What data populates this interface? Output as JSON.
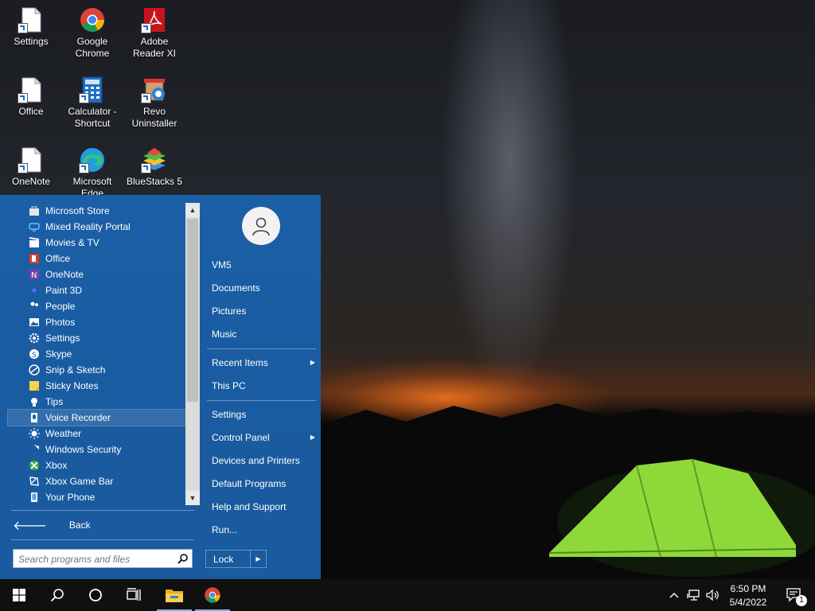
{
  "desktop": {
    "icons": [
      {
        "label": "Settings"
      },
      {
        "label": "Google Chrome"
      },
      {
        "label": "Adobe Reader XI"
      },
      {
        "label": "Office"
      },
      {
        "label": "Calculator - Shortcut"
      },
      {
        "label": "Revo Uninstaller"
      },
      {
        "label": "OneNote"
      },
      {
        "label": "Microsoft Edge"
      },
      {
        "label": "BlueStacks 5"
      }
    ]
  },
  "start_menu": {
    "programs": [
      {
        "label": "Microsoft Store",
        "icon": "store-icon",
        "color": "#e8e8e8"
      },
      {
        "label": "Mixed Reality Portal",
        "icon": "mixed-reality-icon",
        "color": "#5cc3ff"
      },
      {
        "label": "Movies & TV",
        "icon": "movies-icon",
        "color": "#ffffff"
      },
      {
        "label": "Office",
        "icon": "office-icon",
        "color": "#e03c1a"
      },
      {
        "label": "OneNote",
        "icon": "onenote-icon",
        "color": "#7b3fa8"
      },
      {
        "label": "Paint 3D",
        "icon": "paint3d-icon",
        "color": "#f0a030"
      },
      {
        "label": "People",
        "icon": "people-icon",
        "color": "#ffffff"
      },
      {
        "label": "Photos",
        "icon": "photos-icon",
        "color": "#ffffff"
      },
      {
        "label": "Settings",
        "icon": "gear-icon",
        "color": "#ffffff"
      },
      {
        "label": "Skype",
        "icon": "skype-icon",
        "color": "#ffffff"
      },
      {
        "label": "Snip & Sketch",
        "icon": "snip-icon",
        "color": "#ffffff"
      },
      {
        "label": "Sticky Notes",
        "icon": "sticky-notes-icon",
        "color": "#f8d44a"
      },
      {
        "label": "Tips",
        "icon": "tips-icon",
        "color": "#ffffff"
      },
      {
        "label": "Voice Recorder",
        "icon": "microphone-icon",
        "color": "#ffffff",
        "selected": true
      },
      {
        "label": "Weather",
        "icon": "weather-icon",
        "color": "#ffffff"
      },
      {
        "label": "Windows Security",
        "icon": "shield-icon",
        "color": "#ffffff"
      },
      {
        "label": "Xbox",
        "icon": "xbox-icon",
        "color": "#3ab03a"
      },
      {
        "label": "Xbox Game Bar",
        "icon": "game-bar-icon",
        "color": "#ffffff"
      },
      {
        "label": "Your Phone",
        "icon": "phone-icon",
        "color": "#ffffff"
      }
    ],
    "back_label": "Back",
    "search_placeholder": "Search programs and files",
    "right_items": {
      "user": "VM5",
      "documents": "Documents",
      "pictures": "Pictures",
      "music": "Music",
      "recent_items": "Recent Items",
      "this_pc": "This PC",
      "settings": "Settings",
      "control_panel": "Control Panel",
      "devices_printers": "Devices and Printers",
      "default_programs": "Default Programs",
      "help_support": "Help and Support",
      "run": "Run..."
    },
    "lock_label": "Lock"
  },
  "taskbar": {
    "time": "6:50 PM",
    "date": "5/4/2022",
    "notification_count": "1"
  },
  "colors": {
    "start_menu_bg": "#1b5fa6",
    "taskbar_bg": "#101010",
    "accent": "#7ab0e8"
  }
}
